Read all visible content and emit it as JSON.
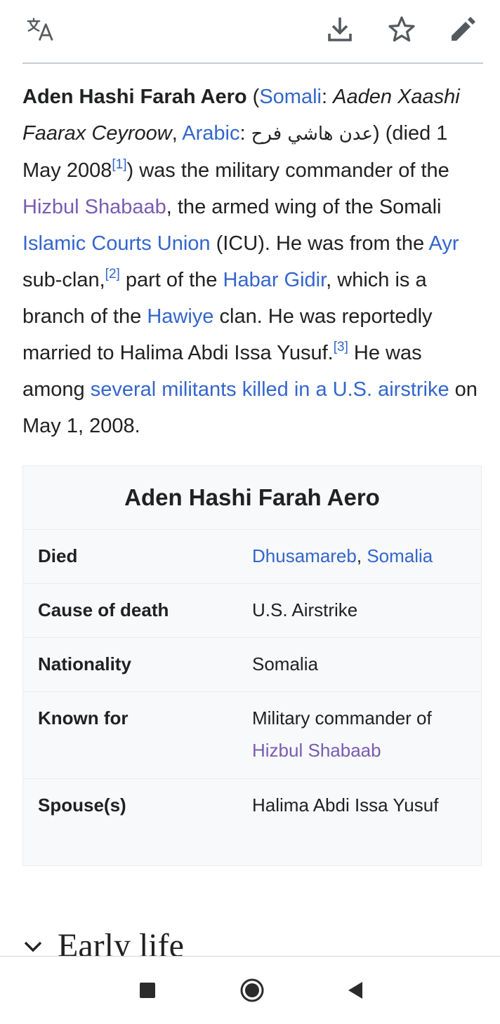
{
  "toolbar": {
    "translate_icon": "translate-icon",
    "download_icon": "download-icon",
    "bookmark_icon": "star-icon",
    "edit_icon": "pencil-icon"
  },
  "intro": {
    "subject": "Aden Hashi Farah Aero",
    "t1": " (",
    "link_somali": "Somali",
    "t2": ": ",
    "somali_name": "Aaden Xaashi Faarax Ceyroow",
    "t3": ", ",
    "link_arabic": "Arabic",
    "t4": ": ",
    "arabic_name": "عدن هاشي فرح",
    "t5": ") (died 1 May 2008",
    "ref1": "[1]",
    "t6": ") was the military commander of the ",
    "link_hizbul": "Hizbul Shabaab",
    "t7": ", the armed wing of the Somali ",
    "link_icu": "Islamic Courts Union",
    "t8": " (ICU). He was from the ",
    "link_ayr": "Ayr",
    "t9": " sub-clan,",
    "ref2": "[2]",
    "t10": " part of the ",
    "link_habar": "Habar Gidir",
    "t11": ", which is a branch of the ",
    "link_hawiye": "Hawiye",
    "t12": " clan. He was reportedly married to Halima Abdi Issa Yusuf.",
    "ref3": "[3]",
    "t13": " He was among ",
    "link_killed": "several militants killed in a U.S. airstrike",
    "t14": " on May 1, 2008."
  },
  "infobox": {
    "title": "Aden Hashi Farah Aero",
    "died_label": "Died",
    "died_link1": "Dhusamareb",
    "died_sep": ", ",
    "died_link2": "Somalia",
    "cause_label": "Cause of death",
    "cause_value": "U.S. Airstrike",
    "nationality_label": "Nationality",
    "nationality_value": "Somalia",
    "known_label": "Known for",
    "known_text": "Military commander of ",
    "known_link": "Hizbul Shabaab",
    "spouse_label": "Spouse(s)",
    "spouse_value": "Halima Abdi Issa Yusuf"
  },
  "section": {
    "heading": "Early life",
    "icon": "chevron-down-icon"
  },
  "navbar": {
    "recents_icon": "square-icon",
    "home_icon": "circle-icon",
    "back_icon": "triangle-back-icon"
  },
  "colors": {
    "link": "#3366cc",
    "visited_link": "#795cb2",
    "text": "#202122",
    "infobox_bg": "#f8f9fa"
  }
}
